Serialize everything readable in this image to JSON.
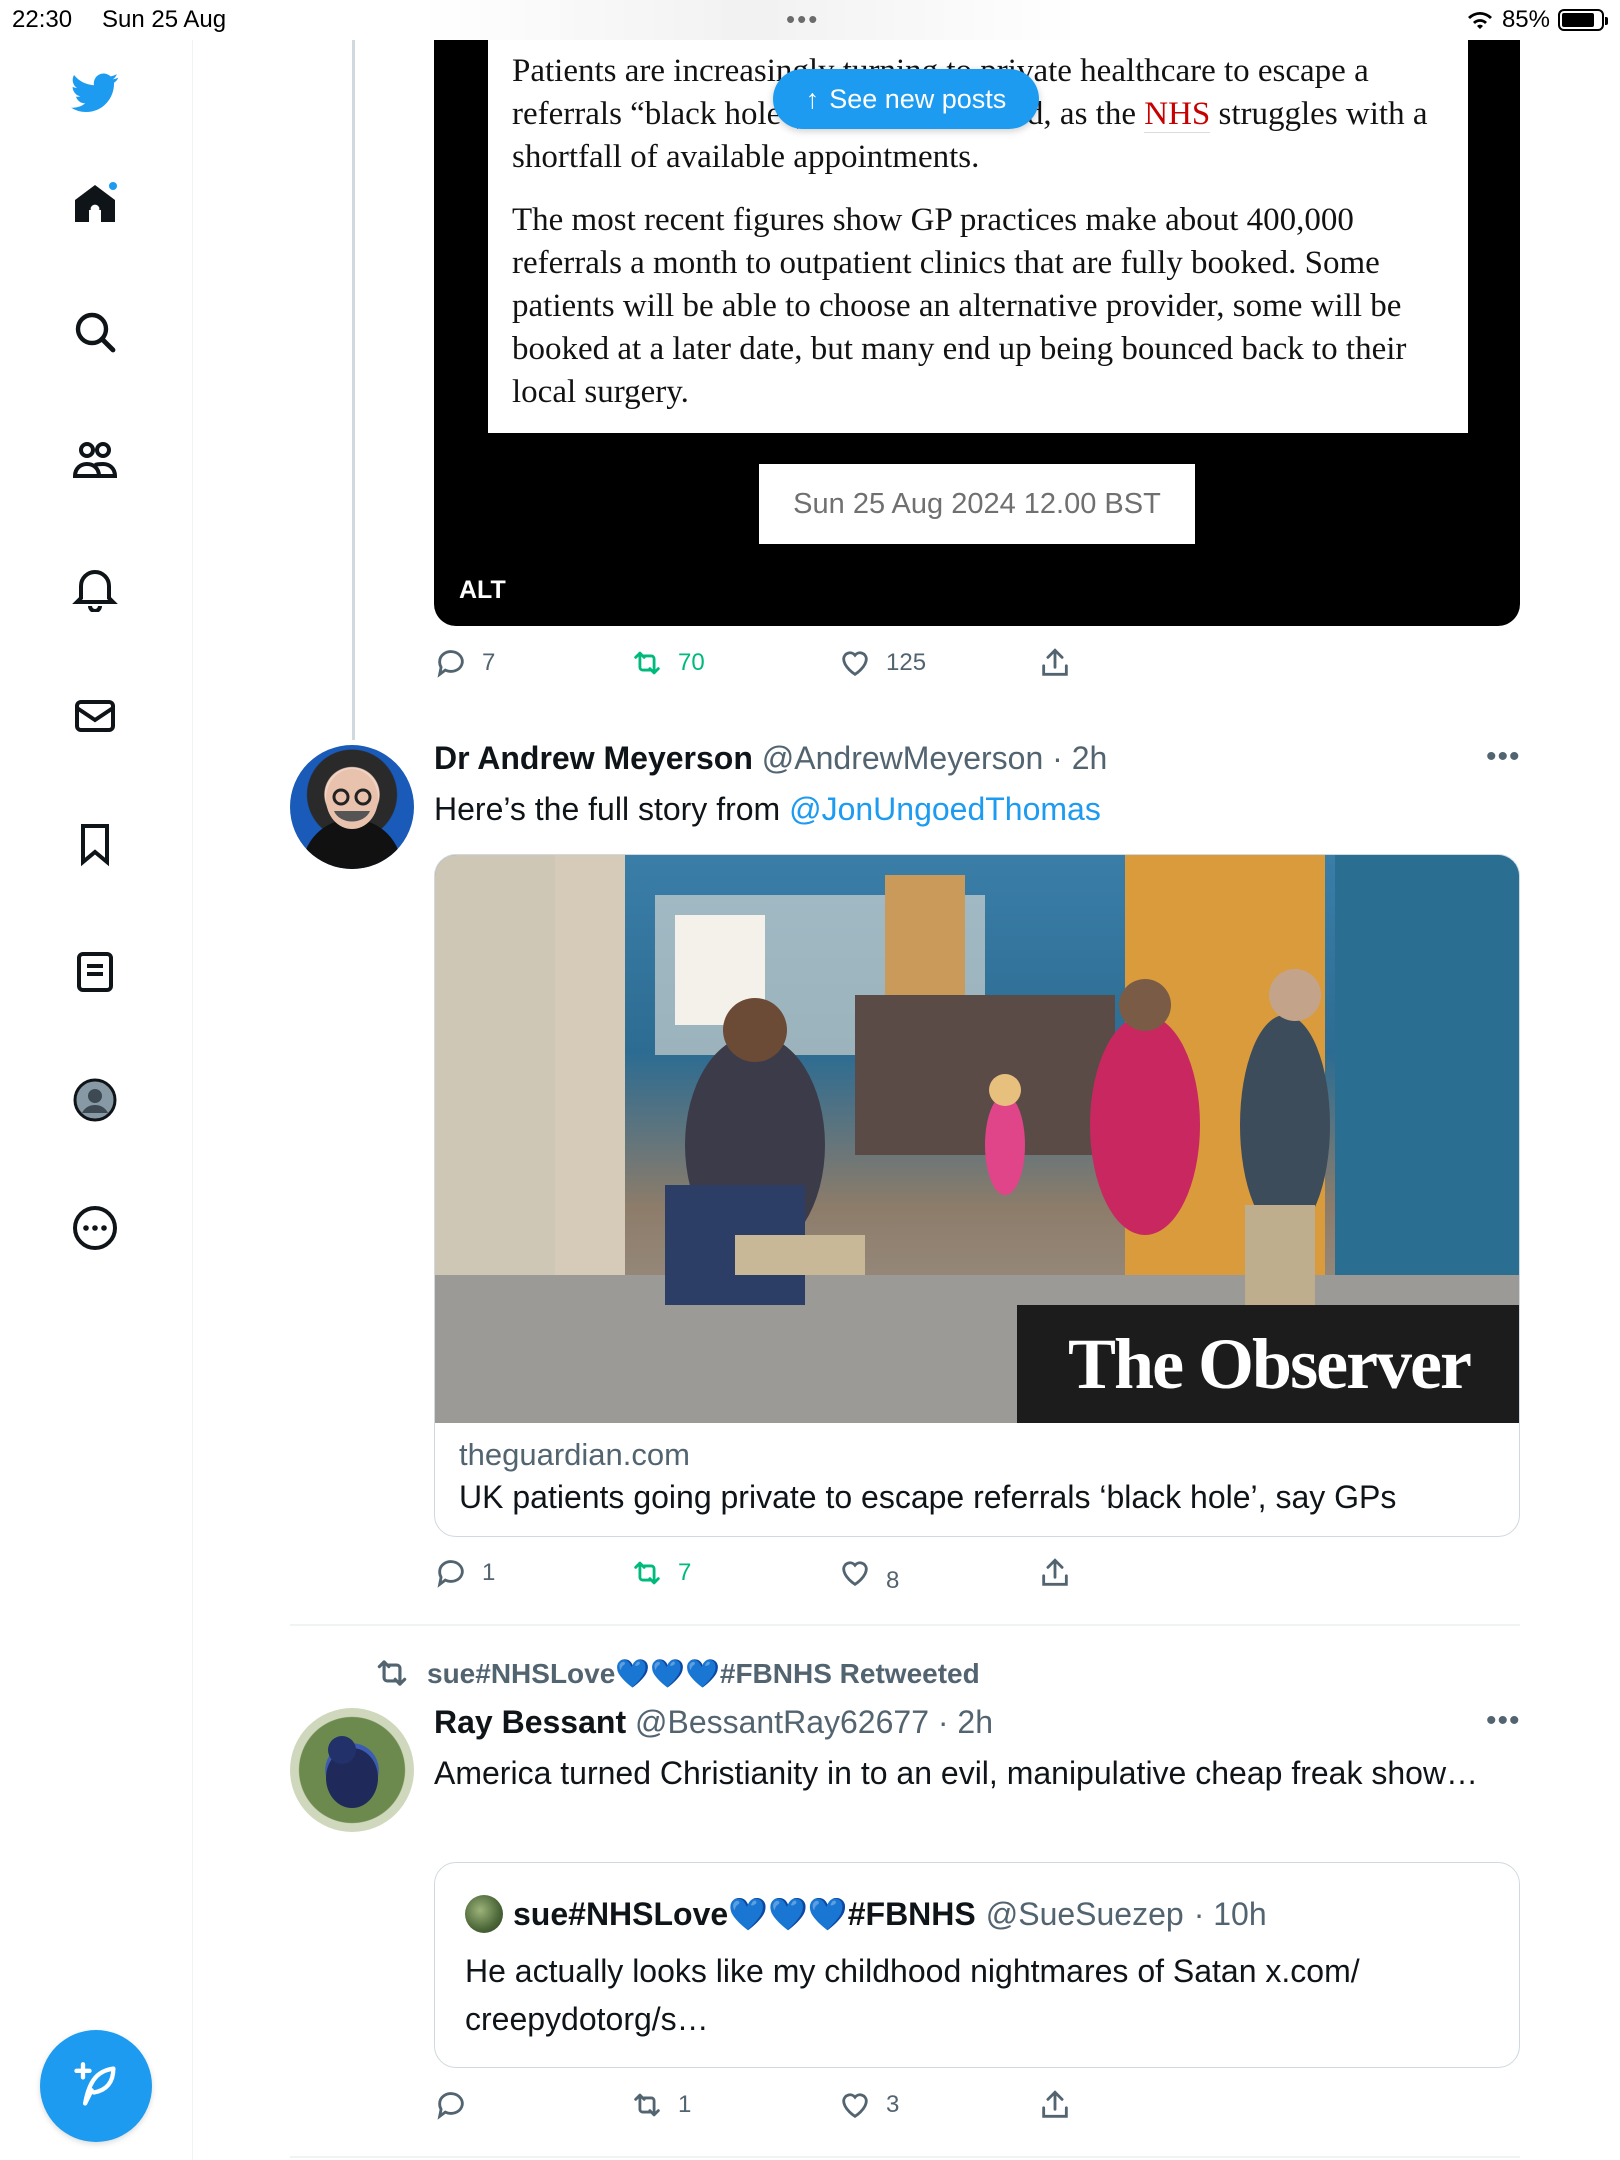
{
  "status_bar": {
    "time": "22:30",
    "date": "Sun 25 Aug",
    "battery": "85%",
    "battery_level": 0.85
  },
  "banner": {
    "see_new_posts": "See new posts"
  },
  "tweet1": {
    "article_paragraph1_a": "Patients are increasingly turning to private healthcare to escape a referrals “black hole”, GPs have warned, as the ",
    "article_nhs": "NHS",
    "article_paragraph1_b": " struggles with a shortfall of available appointments.",
    "article_paragraph2": "The most recent figures show GP practices make about 400,000 referrals a month to outpatient clinics that are fully booked. Some patients will be able to choose an alternative provider, some will be booked at a later date, but many end up being bounced back to their local surgery.",
    "image_date": "Sun 25 Aug 2024 12.00 BST",
    "alt_label": "ALT",
    "replies": "7",
    "retweets": "70",
    "likes": "125"
  },
  "tweet2": {
    "name": "Dr Andrew Meyerson",
    "handle": "@AndrewMeyerson",
    "time": "· 2h",
    "text": "Here’s the full story from ",
    "mention": "@JonUngoedThomas",
    "card_overlay": "The Observer",
    "card_domain": "theguardian.com",
    "card_title": "UK patients going private to escape referrals ‘black hole’, say GPs",
    "replies": "1",
    "retweets": "7",
    "likes": "8"
  },
  "tweet3": {
    "retweeted_by": "sue#NHSLove💙💙💙#FBNHS Retweeted",
    "name": "Ray Bessant",
    "handle": "@BessantRay62677",
    "time": "· 2h",
    "text": "America turned Christianity in to an evil, manipulative cheap freak show…",
    "quote_name": "sue#NHSLove💙💙💙#FBNHS",
    "quote_handle": "@SueSuezep",
    "quote_time": "· 10h",
    "quote_text": "He actually looks like my childhood nightmares of Satan x.com/ creepydotorg/s…",
    "replies": "",
    "retweets": "1",
    "likes": "3"
  },
  "colors": {
    "accent": "#1d9bf0",
    "retweet": "#00ba7c",
    "muted": "#536471"
  },
  "icons": [
    "twitter-bird-icon",
    "home-icon",
    "search-icon",
    "communities-icon",
    "notifications-icon",
    "messages-icon",
    "bookmarks-icon",
    "lists-icon",
    "profile-icon",
    "more-icon",
    "compose-icon",
    "reply-icon",
    "retweet-icon",
    "like-icon",
    "share-icon",
    "more-dots-icon"
  ]
}
